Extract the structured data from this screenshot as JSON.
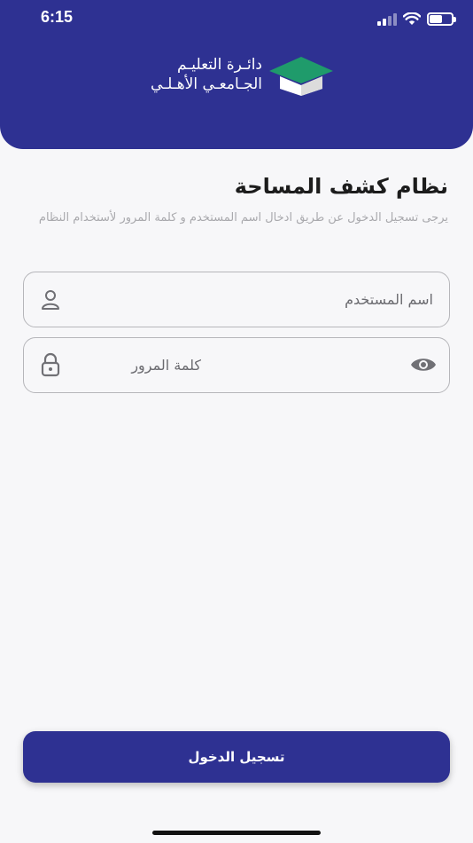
{
  "status_bar": {
    "time": "6:15",
    "icons": [
      "cellular-signal-icon",
      "wifi-icon",
      "battery-icon"
    ]
  },
  "header": {
    "logo_line1": "دائـرة التعليـم",
    "logo_line2": "الجـامعـي الأهـلـي",
    "logo_icon": "graduation-cap-icon",
    "background_color": "#2e3192",
    "accent_color": "#1f9b6b"
  },
  "main": {
    "title": "نظام كشف المساحة",
    "subtitle": "يرجى تسجيل الدخول عن طريق ادخال اسم المستخدم و كلمة المرور لأستخدام النظام"
  },
  "form": {
    "username": {
      "placeholder": "اسم المستخدم",
      "value": "",
      "icon": "person-icon"
    },
    "password": {
      "placeholder": "كلمة المرور",
      "value": "",
      "icon": "lock-icon",
      "toggle_icon": "eye-icon"
    }
  },
  "login_button": {
    "label": "تسجيل الدخول"
  }
}
